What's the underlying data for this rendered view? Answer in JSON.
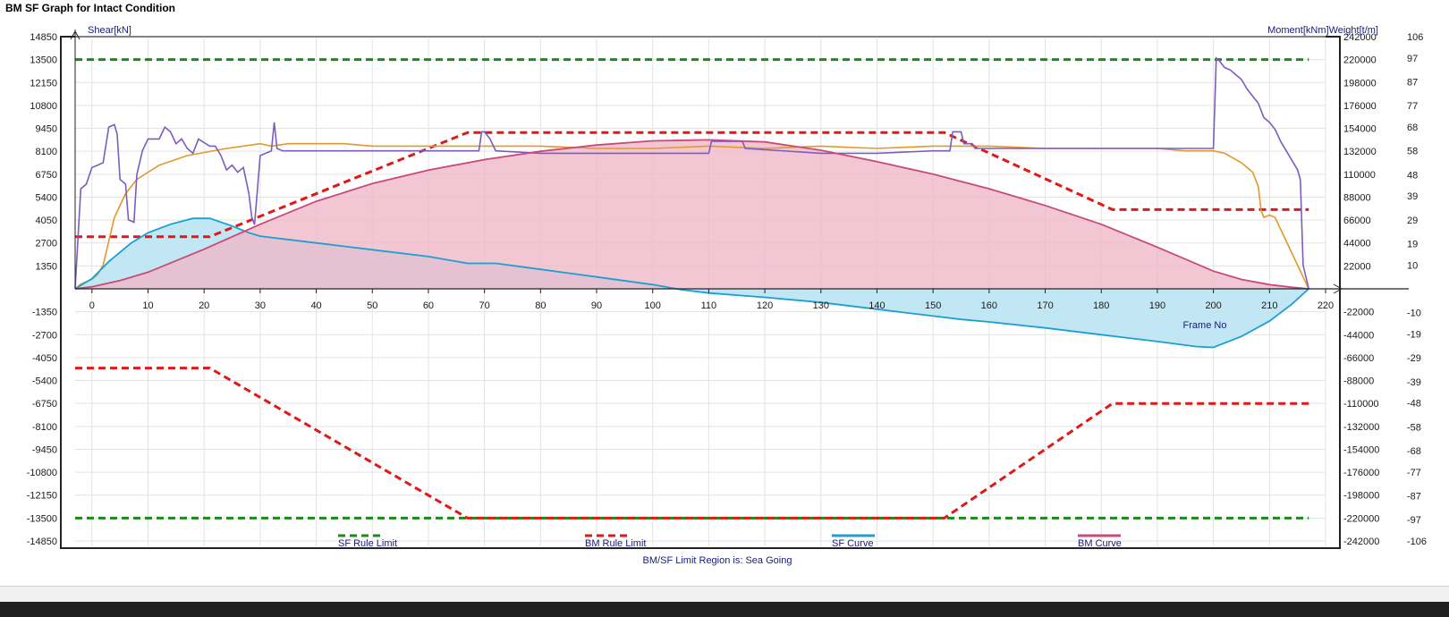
{
  "window": {
    "title": "BM SF Graph for Intact Condition"
  },
  "colors": {
    "sf_limit": "#1a8a1a",
    "bm_limit": "#e01818",
    "sf_line": "#1c9fd1",
    "sf_fill": "#bfe6f3",
    "bm_line": "#c84a7a",
    "bm_fill": "#f0b6c8",
    "weight": "#7b5cc0",
    "orange": "#e4982a"
  },
  "chart_data": {
    "type": "line",
    "title": "BM SF Graph for Intact Condition",
    "xlabel": "Frame No",
    "ylabel_left": "Shear[kN]",
    "ylabel_right": "Moment[kNm]Weight[t/m]",
    "footer": "BM/SF Limit Region is:  Sea Going",
    "xlim": [
      -3,
      220
    ],
    "ylim_shear": [
      -14850,
      14850
    ],
    "ylim_moment": [
      -242000,
      242000
    ],
    "ylim_weight": [
      -106,
      106
    ],
    "x_ticks": [
      0,
      10,
      20,
      30,
      40,
      50,
      60,
      70,
      80,
      90,
      100,
      110,
      120,
      130,
      140,
      150,
      160,
      170,
      180,
      190,
      200,
      210,
      220
    ],
    "shear_ticks": [
      14850,
      13500,
      12150,
      10800,
      9450,
      8100,
      6750,
      5400,
      4050,
      2700,
      1350,
      -1350,
      -2700,
      -4050,
      -5400,
      -6750,
      -8100,
      -9450,
      -10800,
      -12150,
      -13500,
      -14850
    ],
    "moment_ticks": [
      242000,
      220000,
      198000,
      176000,
      154000,
      132000,
      110000,
      88000,
      66000,
      44000,
      22000,
      -22000,
      -44000,
      -66000,
      -88000,
      -110000,
      -132000,
      -154000,
      -176000,
      -198000,
      -220000,
      -242000
    ],
    "weight_ticks": [
      106,
      97,
      87,
      77,
      68,
      58,
      48,
      39,
      29,
      19,
      10,
      -10,
      -19,
      -29,
      -39,
      -48,
      -58,
      -68,
      -77,
      -87,
      -97,
      -106
    ],
    "legend": [
      {
        "name": "SF Rule Limit",
        "color": "#1a8a1a",
        "style": "dashed"
      },
      {
        "name": "BM Rule Limit",
        "color": "#e01818",
        "style": "dashed"
      },
      {
        "name": "SF Curve",
        "color": "#1c9fd1",
        "style": "solid"
      },
      {
        "name": "BM Curve",
        "color": "#c84a7a",
        "style": "solid"
      }
    ],
    "series": [
      {
        "name": "SF Rule Limit",
        "axis": "shear",
        "segments": [
          [
            [
              -3,
              13500
            ],
            [
              217,
              13500
            ]
          ],
          [
            [
              -3,
              -13500
            ],
            [
              217,
              -13500
            ]
          ]
        ]
      },
      {
        "name": "BM Rule Limit",
        "axis": "moment",
        "segments": [
          [
            [
              -3,
              50000
            ],
            [
              21,
              50000
            ],
            [
              67,
              150000
            ],
            [
              152,
              150000
            ],
            [
              182,
              76000
            ],
            [
              217,
              76000
            ]
          ],
          [
            [
              -3,
              -76000
            ],
            [
              21,
              -76000
            ],
            [
              67,
              -220000
            ],
            [
              152,
              -220000
            ],
            [
              182,
              -110000
            ],
            [
              217,
              -110000
            ]
          ]
        ]
      },
      {
        "name": "SF Curve",
        "axis": "shear",
        "points": [
          [
            -3,
            0
          ],
          [
            0,
            600
          ],
          [
            3,
            1600
          ],
          [
            7,
            2700
          ],
          [
            10,
            3300
          ],
          [
            14,
            3800
          ],
          [
            18,
            4150
          ],
          [
            21,
            4150
          ],
          [
            25,
            3700
          ],
          [
            28,
            3300
          ],
          [
            30,
            3100
          ],
          [
            40,
            2700
          ],
          [
            50,
            2300
          ],
          [
            60,
            1900
          ],
          [
            67,
            1500
          ],
          [
            72,
            1500
          ],
          [
            80,
            1150
          ],
          [
            90,
            700
          ],
          [
            100,
            250
          ],
          [
            105,
            -50
          ],
          [
            110,
            -250
          ],
          [
            120,
            -500
          ],
          [
            130,
            -800
          ],
          [
            140,
            -1200
          ],
          [
            150,
            -1600
          ],
          [
            155,
            -1800
          ],
          [
            160,
            -1950
          ],
          [
            170,
            -2300
          ],
          [
            180,
            -2700
          ],
          [
            190,
            -3100
          ],
          [
            197,
            -3400
          ],
          [
            200,
            -3450
          ],
          [
            205,
            -2800
          ],
          [
            210,
            -1900
          ],
          [
            214,
            -900
          ],
          [
            217,
            0
          ]
        ]
      },
      {
        "name": "BM Curve",
        "axis": "moment",
        "points": [
          [
            -3,
            0
          ],
          [
            0,
            2000
          ],
          [
            5,
            8000
          ],
          [
            10,
            16000
          ],
          [
            20,
            38000
          ],
          [
            30,
            62000
          ],
          [
            40,
            84000
          ],
          [
            50,
            101000
          ],
          [
            60,
            114000
          ],
          [
            70,
            124000
          ],
          [
            80,
            132000
          ],
          [
            90,
            138000
          ],
          [
            100,
            142000
          ],
          [
            110,
            143000
          ],
          [
            120,
            141000
          ],
          [
            130,
            133000
          ],
          [
            140,
            122000
          ],
          [
            150,
            110000
          ],
          [
            160,
            96000
          ],
          [
            170,
            80000
          ],
          [
            180,
            62000
          ],
          [
            190,
            40000
          ],
          [
            200,
            17000
          ],
          [
            205,
            9000
          ],
          [
            210,
            4000
          ],
          [
            214,
            1500
          ],
          [
            217,
            0
          ]
        ]
      },
      {
        "name": "Weight",
        "axis": "weight",
        "points": [
          [
            -3,
            0
          ],
          [
            -2,
            42
          ],
          [
            -1,
            44
          ],
          [
            0,
            51
          ],
          [
            1,
            52
          ],
          [
            2,
            53
          ],
          [
            3,
            68
          ],
          [
            4,
            69
          ],
          [
            4.5,
            65
          ],
          [
            5,
            46
          ],
          [
            6,
            44
          ],
          [
            6.5,
            29
          ],
          [
            7.5,
            28
          ],
          [
            8,
            48
          ],
          [
            9,
            58
          ],
          [
            10,
            63
          ],
          [
            12,
            63
          ],
          [
            13,
            68
          ],
          [
            14,
            66
          ],
          [
            15,
            61
          ],
          [
            16,
            63
          ],
          [
            17,
            59
          ],
          [
            18,
            57
          ],
          [
            19,
            63
          ],
          [
            21,
            60
          ],
          [
            22,
            60
          ],
          [
            23,
            56
          ],
          [
            24,
            50
          ],
          [
            25,
            52
          ],
          [
            26,
            49
          ],
          [
            27,
            51
          ],
          [
            28,
            40
          ],
          [
            28.5,
            30
          ],
          [
            29,
            27
          ],
          [
            30,
            56
          ],
          [
            31,
            57
          ],
          [
            32,
            58
          ],
          [
            32.5,
            70
          ],
          [
            33,
            59
          ],
          [
            34,
            58
          ],
          [
            40,
            58
          ],
          [
            50,
            58
          ],
          [
            60,
            58
          ],
          [
            69,
            58
          ],
          [
            69.5,
            66
          ],
          [
            70,
            66
          ],
          [
            71,
            63
          ],
          [
            72,
            58
          ],
          [
            80,
            57
          ],
          [
            90,
            57
          ],
          [
            100,
            57
          ],
          [
            110,
            57
          ],
          [
            110.5,
            62
          ],
          [
            116,
            62
          ],
          [
            116.5,
            59
          ],
          [
            130,
            57
          ],
          [
            140,
            57
          ],
          [
            150,
            58
          ],
          [
            153,
            58
          ],
          [
            153.5,
            66
          ],
          [
            155,
            66
          ],
          [
            155.5,
            61
          ],
          [
            157,
            61
          ],
          [
            157.5,
            59
          ],
          [
            170,
            59
          ],
          [
            180,
            59
          ],
          [
            190,
            59
          ],
          [
            200,
            59
          ],
          [
            200.5,
            97
          ],
          [
            201,
            96
          ],
          [
            202,
            93
          ],
          [
            203,
            92
          ],
          [
            204,
            90
          ],
          [
            205,
            88
          ],
          [
            206,
            84
          ],
          [
            207,
            81
          ],
          [
            208,
            78
          ],
          [
            209,
            72
          ],
          [
            210,
            70
          ],
          [
            211,
            67
          ],
          [
            212,
            62
          ],
          [
            213,
            58
          ],
          [
            214,
            54
          ],
          [
            215,
            50
          ],
          [
            215.5,
            46
          ],
          [
            216,
            10
          ],
          [
            217,
            0
          ]
        ]
      },
      {
        "name": "Orange",
        "axis": "weight",
        "points": [
          [
            -3,
            0
          ],
          [
            -2,
            2
          ],
          [
            0,
            4
          ],
          [
            1,
            6
          ],
          [
            2,
            10
          ],
          [
            3,
            20
          ],
          [
            4,
            30
          ],
          [
            6,
            40
          ],
          [
            8,
            46
          ],
          [
            12,
            52
          ],
          [
            17,
            56
          ],
          [
            24,
            59
          ],
          [
            30,
            61
          ],
          [
            32,
            60
          ],
          [
            35,
            61
          ],
          [
            40,
            61
          ],
          [
            45,
            61
          ],
          [
            50,
            60
          ],
          [
            60,
            60
          ],
          [
            70,
            60
          ],
          [
            80,
            60
          ],
          [
            90,
            59
          ],
          [
            100,
            59
          ],
          [
            110,
            60
          ],
          [
            120,
            59
          ],
          [
            130,
            60
          ],
          [
            140,
            59
          ],
          [
            150,
            60
          ],
          [
            160,
            60
          ],
          [
            170,
            59
          ],
          [
            180,
            59
          ],
          [
            190,
            59
          ],
          [
            195,
            58
          ],
          [
            200,
            58
          ],
          [
            202,
            57
          ],
          [
            205,
            53
          ],
          [
            207,
            49
          ],
          [
            208,
            43
          ],
          [
            208.5,
            33
          ],
          [
            209,
            30
          ],
          [
            210,
            31
          ],
          [
            211,
            30
          ],
          [
            212,
            25
          ],
          [
            214,
            15
          ],
          [
            216,
            5
          ],
          [
            217,
            0
          ]
        ]
      }
    ]
  }
}
